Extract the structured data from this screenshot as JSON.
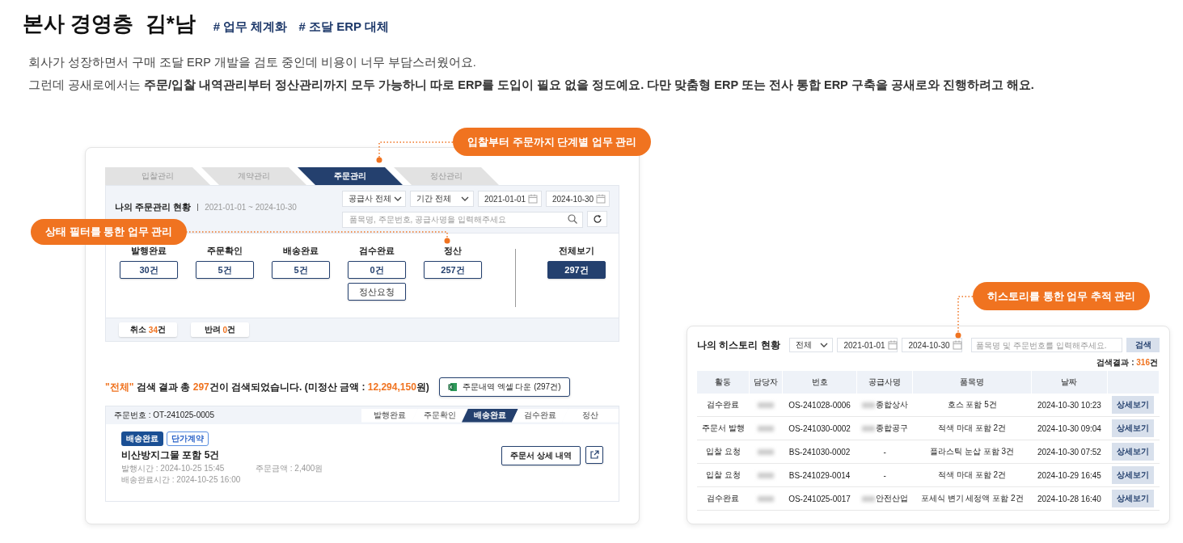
{
  "header": {
    "title": "본사 경영층  김*남",
    "tags": [
      "# 업무 체계화",
      "# 조달 ERP 대체"
    ]
  },
  "intro": [
    "회사가 성장하면서 구매 조달 ERP 개발을 검토 중인데 비용이 너무 부담스러웠어요.",
    "그런데 공새로에서는 **주문/입찰 내역관리부터 정산관리까지 모두 가능하니 따로 ERP를 도입이 필요 없을 정도예요. 다만 맞춤형 ERP 또는 전사 통합 ERP 구축을 공새로와 진행하려고 해요.**"
  ],
  "callouts": [
    "입찰부터 주문까지 단계별 업무 관리",
    "상태 필터를 통한 업무 관리",
    "히스토리를 통한 업무 추적 관리"
  ],
  "order_screen": {
    "stages": [
      {
        "label": "입찰관리",
        "selected": false
      },
      {
        "label": "계약관리",
        "selected": false
      },
      {
        "label": "주문관리",
        "selected": true
      },
      {
        "label": "정산관리",
        "selected": false
      }
    ],
    "title": "나의 주문관리 현황",
    "period": "2021-01-01 ~ 2024-10-30",
    "filters": [
      {
        "kind": "select",
        "value": "공급사 전체"
      },
      {
        "kind": "select",
        "value": "기간 전체"
      },
      {
        "kind": "date",
        "value": "2021-01-01"
      },
      {
        "kind": "date",
        "value": "2024-10-30"
      }
    ],
    "search": {
      "placeholder": "품목명, 주문번호, 공급사명을 입력해주세요"
    },
    "statuses": [
      {
        "label": "발행완료",
        "count": "30건",
        "selected": false
      },
      {
        "label": "주문확인",
        "count": "5건",
        "selected": false
      },
      {
        "label": "배송완료",
        "count": "5건",
        "selected": false
      },
      {
        "label": "검수완료",
        "count": "0건",
        "selected": false,
        "action": "정산요청"
      },
      {
        "label": "정산",
        "count": "257건",
        "selected": false
      }
    ],
    "total": {
      "label": "전체보기",
      "count": "297건",
      "selected": true
    },
    "extras": [
      {
        "label": "취소",
        "number": "34",
        "unit": "건"
      },
      {
        "label": "반려",
        "number": "0",
        "unit": "건"
      }
    ],
    "result": {
      "filter": "\"전체\"",
      "text1": " 검색 결과 총 ",
      "count": "297",
      "text2": "건이 검색되었습니다. (미정산 금액 : ",
      "amount": "12,294,150",
      "text3": "원)"
    },
    "excel_button": "주문내역 엑셀 다운 (297건)",
    "order": {
      "number": "주문번호 : OT-241025-0005",
      "steps": [
        {
          "label": "발행완료",
          "selected": false
        },
        {
          "label": "주문확인",
          "selected": false
        },
        {
          "label": "배송완료",
          "selected": true
        },
        {
          "label": "검수완료",
          "selected": false
        },
        {
          "label": "정산",
          "selected": false
        }
      ],
      "badges": [
        {
          "label": "배송완료",
          "kind": "filled"
        },
        {
          "label": "단가계약",
          "kind": "outline"
        }
      ],
      "name": "비산방지그물 포함 5건",
      "meta": [
        "발행시간 : 2024-10-25 15:45",
        "주문금액 : 2,400원",
        "배송완료시간 : 2024-10-25 16:00"
      ],
      "detail_button": "주문서 상세 내역"
    }
  },
  "history": {
    "title": "나의 히스토리 현황",
    "filters": [
      {
        "kind": "select",
        "value": "전체"
      },
      {
        "kind": "date",
        "value": "2021-01-01"
      },
      {
        "kind": "date",
        "value": "2024-10-30"
      }
    ],
    "search": {
      "placeholder": "품목명 및 주문번호를 입력해주세요."
    },
    "search_button": "검색",
    "result_label": "검색결과 : ",
    "result_count": "316",
    "result_unit": "건",
    "columns": [
      "활동",
      "담당자",
      "번호",
      "공급사명",
      "품목명",
      "날짜"
    ],
    "rows": [
      {
        "activity": "검수완료",
        "manager_redacted": true,
        "number": "OS-241028-0006",
        "supplier_redacted": true,
        "supplier": "종합상사",
        "item": "호스 포함 5건",
        "date": "2024-10-30 10:23",
        "action": "상세보기"
      },
      {
        "activity": "주문서 발행",
        "manager_redacted": true,
        "number": "OS-241030-0002",
        "supplier_redacted": true,
        "supplier": "종합공구",
        "item": "적색 마대 포함 2건",
        "date": "2024-10-30 09:04",
        "action": "상세보기"
      },
      {
        "activity": "입찰 요청",
        "manager_redacted": true,
        "number": "BS-241030-0002",
        "supplier_redacted": false,
        "supplier": "-",
        "item": "플라스틱 눈삽 포함 3건",
        "date": "2024-10-30 07:52",
        "action": "상세보기"
      },
      {
        "activity": "입찰 요청",
        "manager_redacted": true,
        "number": "BS-241029-0014",
        "supplier_redacted": false,
        "supplier": "-",
        "item": "적색 마대 포함 2건",
        "date": "2024-10-29 16:45",
        "action": "상세보기"
      },
      {
        "activity": "검수완료",
        "manager_redacted": true,
        "number": "OS-241025-0017",
        "supplier_redacted": true,
        "supplier": "안전산업",
        "item": "포세식 변기 세정액 포함 2건",
        "date": "2024-10-28 16:40",
        "action": "상세보기"
      }
    ]
  }
}
